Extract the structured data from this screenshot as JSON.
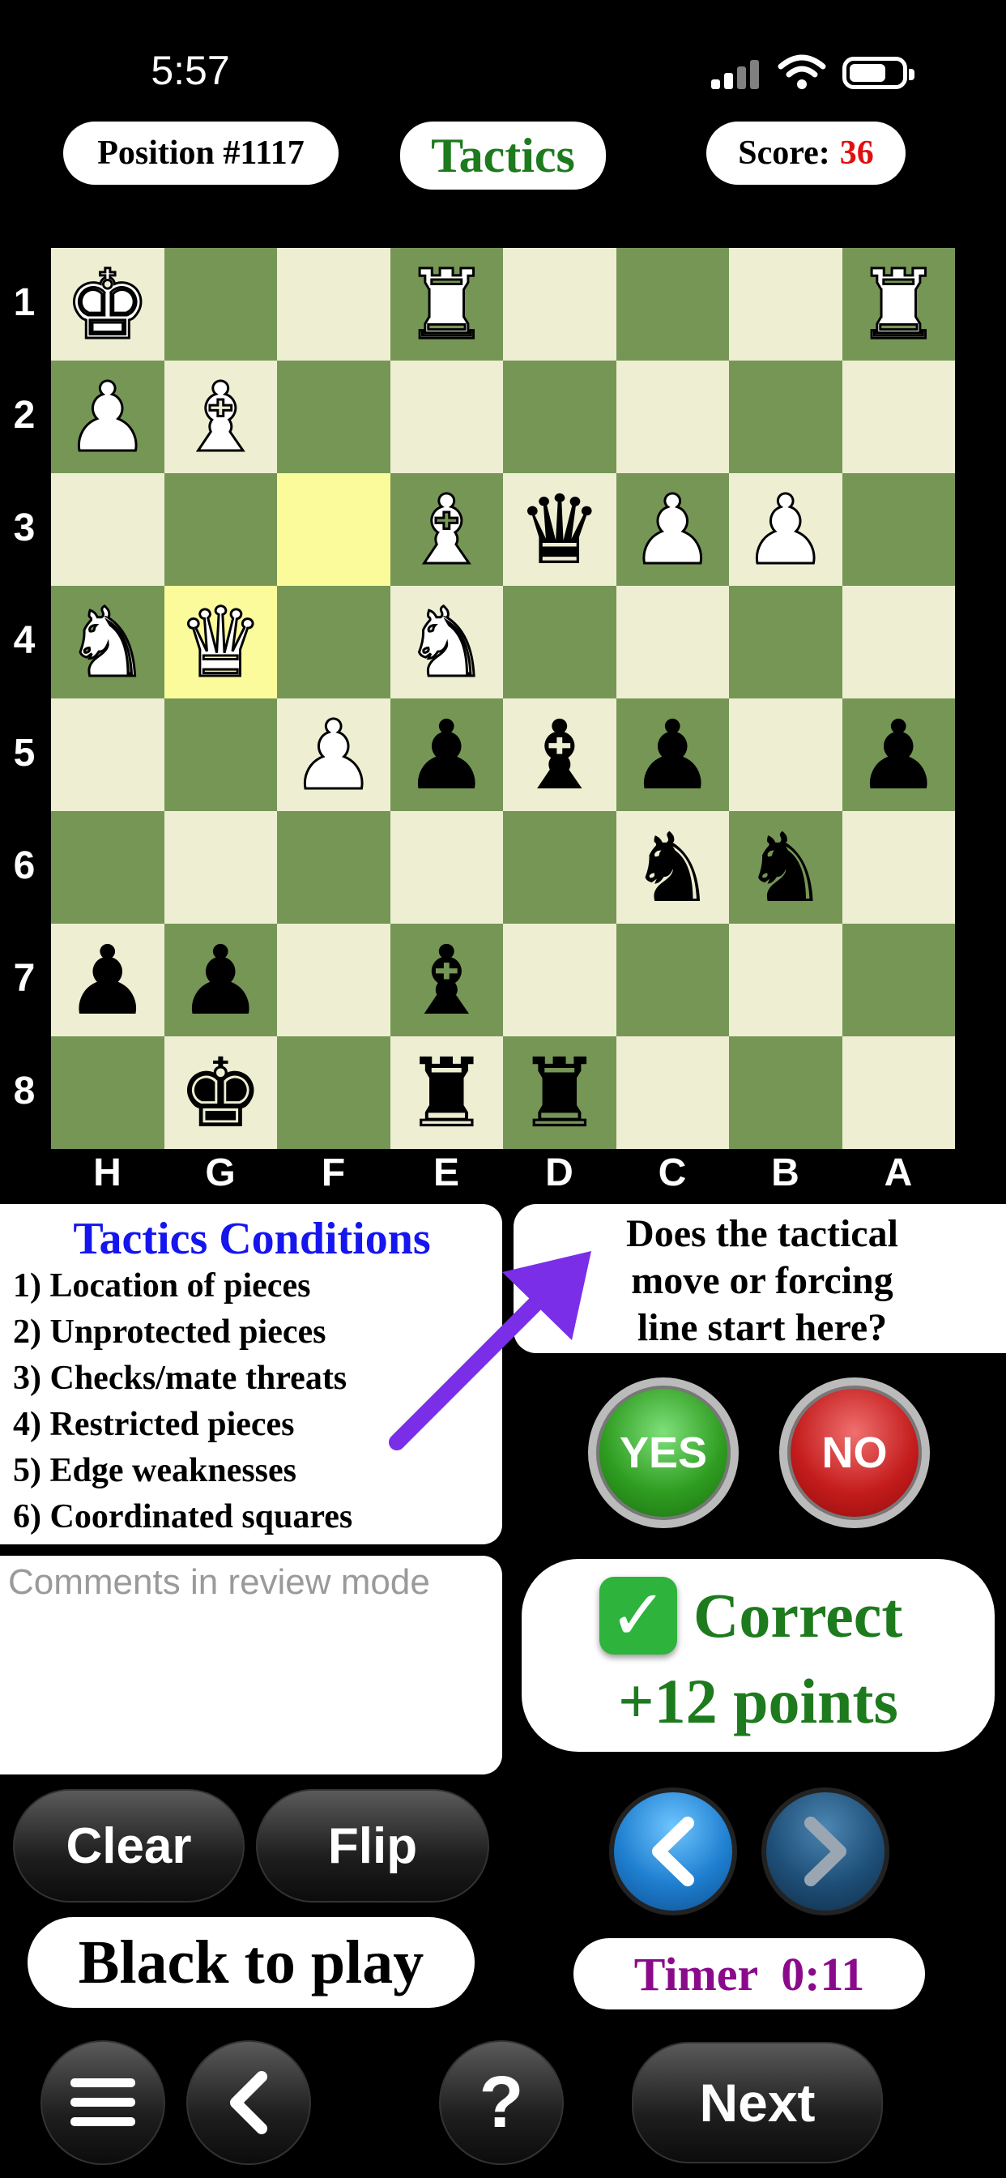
{
  "status_bar": {
    "time": "5:57"
  },
  "header": {
    "position_label": "Position #1117",
    "mode_label": "Tactics",
    "score_label": "Score:",
    "score_value": "36"
  },
  "board": {
    "ranks": [
      "1",
      "2",
      "3",
      "4",
      "5",
      "6",
      "7",
      "8"
    ],
    "files": [
      "H",
      "G",
      "F",
      "E",
      "D",
      "C",
      "B",
      "A"
    ],
    "highlighted_squares": [
      "F3",
      "G4"
    ],
    "colors": {
      "light": "#eeeed2",
      "dark": "#769656",
      "highlight": "#fbfb9c"
    },
    "pieces": [
      {
        "square": "H1",
        "color": "white",
        "piece": "king"
      },
      {
        "square": "E1",
        "color": "white",
        "piece": "rook"
      },
      {
        "square": "A1",
        "color": "white",
        "piece": "rook"
      },
      {
        "square": "H2",
        "color": "white",
        "piece": "pawn"
      },
      {
        "square": "G2",
        "color": "white",
        "piece": "bishop"
      },
      {
        "square": "E3",
        "color": "white",
        "piece": "bishop"
      },
      {
        "square": "D3",
        "color": "black",
        "piece": "queen"
      },
      {
        "square": "C3",
        "color": "white",
        "piece": "pawn"
      },
      {
        "square": "B3",
        "color": "white",
        "piece": "pawn"
      },
      {
        "square": "H4",
        "color": "white",
        "piece": "knight"
      },
      {
        "square": "G4",
        "color": "white",
        "piece": "queen"
      },
      {
        "square": "E4",
        "color": "white",
        "piece": "knight"
      },
      {
        "square": "F5",
        "color": "white",
        "piece": "pawn"
      },
      {
        "square": "E5",
        "color": "black",
        "piece": "pawn"
      },
      {
        "square": "D5",
        "color": "black",
        "piece": "bishop"
      },
      {
        "square": "C5",
        "color": "black",
        "piece": "pawn"
      },
      {
        "square": "A5",
        "color": "black",
        "piece": "pawn"
      },
      {
        "square": "C6",
        "color": "black",
        "piece": "knight"
      },
      {
        "square": "B6",
        "color": "black",
        "piece": "knight"
      },
      {
        "square": "H7",
        "color": "black",
        "piece": "pawn"
      },
      {
        "square": "G7",
        "color": "black",
        "piece": "pawn"
      },
      {
        "square": "E7",
        "color": "black",
        "piece": "bishop"
      },
      {
        "square": "G8",
        "color": "black",
        "piece": "king"
      },
      {
        "square": "E8",
        "color": "black",
        "piece": "rook"
      },
      {
        "square": "D8",
        "color": "black",
        "piece": "rook"
      }
    ]
  },
  "conditions": {
    "title": "Tactics Conditions",
    "items": [
      "1) Location of pieces",
      "2) Unprotected pieces",
      "3) Checks/mate threats",
      "4) Restricted pieces",
      "5) Edge weaknesses",
      "6) Coordinated squares"
    ]
  },
  "question": {
    "line1": "Does the tactical",
    "line2": "move or forcing",
    "line3": "line start here?"
  },
  "answer_buttons": {
    "yes": "YES",
    "no": "NO"
  },
  "comments": {
    "placeholder": "Comments in review mode"
  },
  "result": {
    "check_icon": "check-mark-icon",
    "status": "Correct",
    "points": "+12 points"
  },
  "controls": {
    "clear": "Clear",
    "flip": "Flip",
    "to_play": "Black to play",
    "timer": "Timer  0:11",
    "help": "?",
    "next": "Next"
  },
  "accent_colors": {
    "tactics_green": "#1d7a1d",
    "score_red": "#e01010",
    "conditions_blue": "#1515ee",
    "arrow_purple": "#7a2ee8",
    "timer_purple": "#8b0a8b"
  }
}
